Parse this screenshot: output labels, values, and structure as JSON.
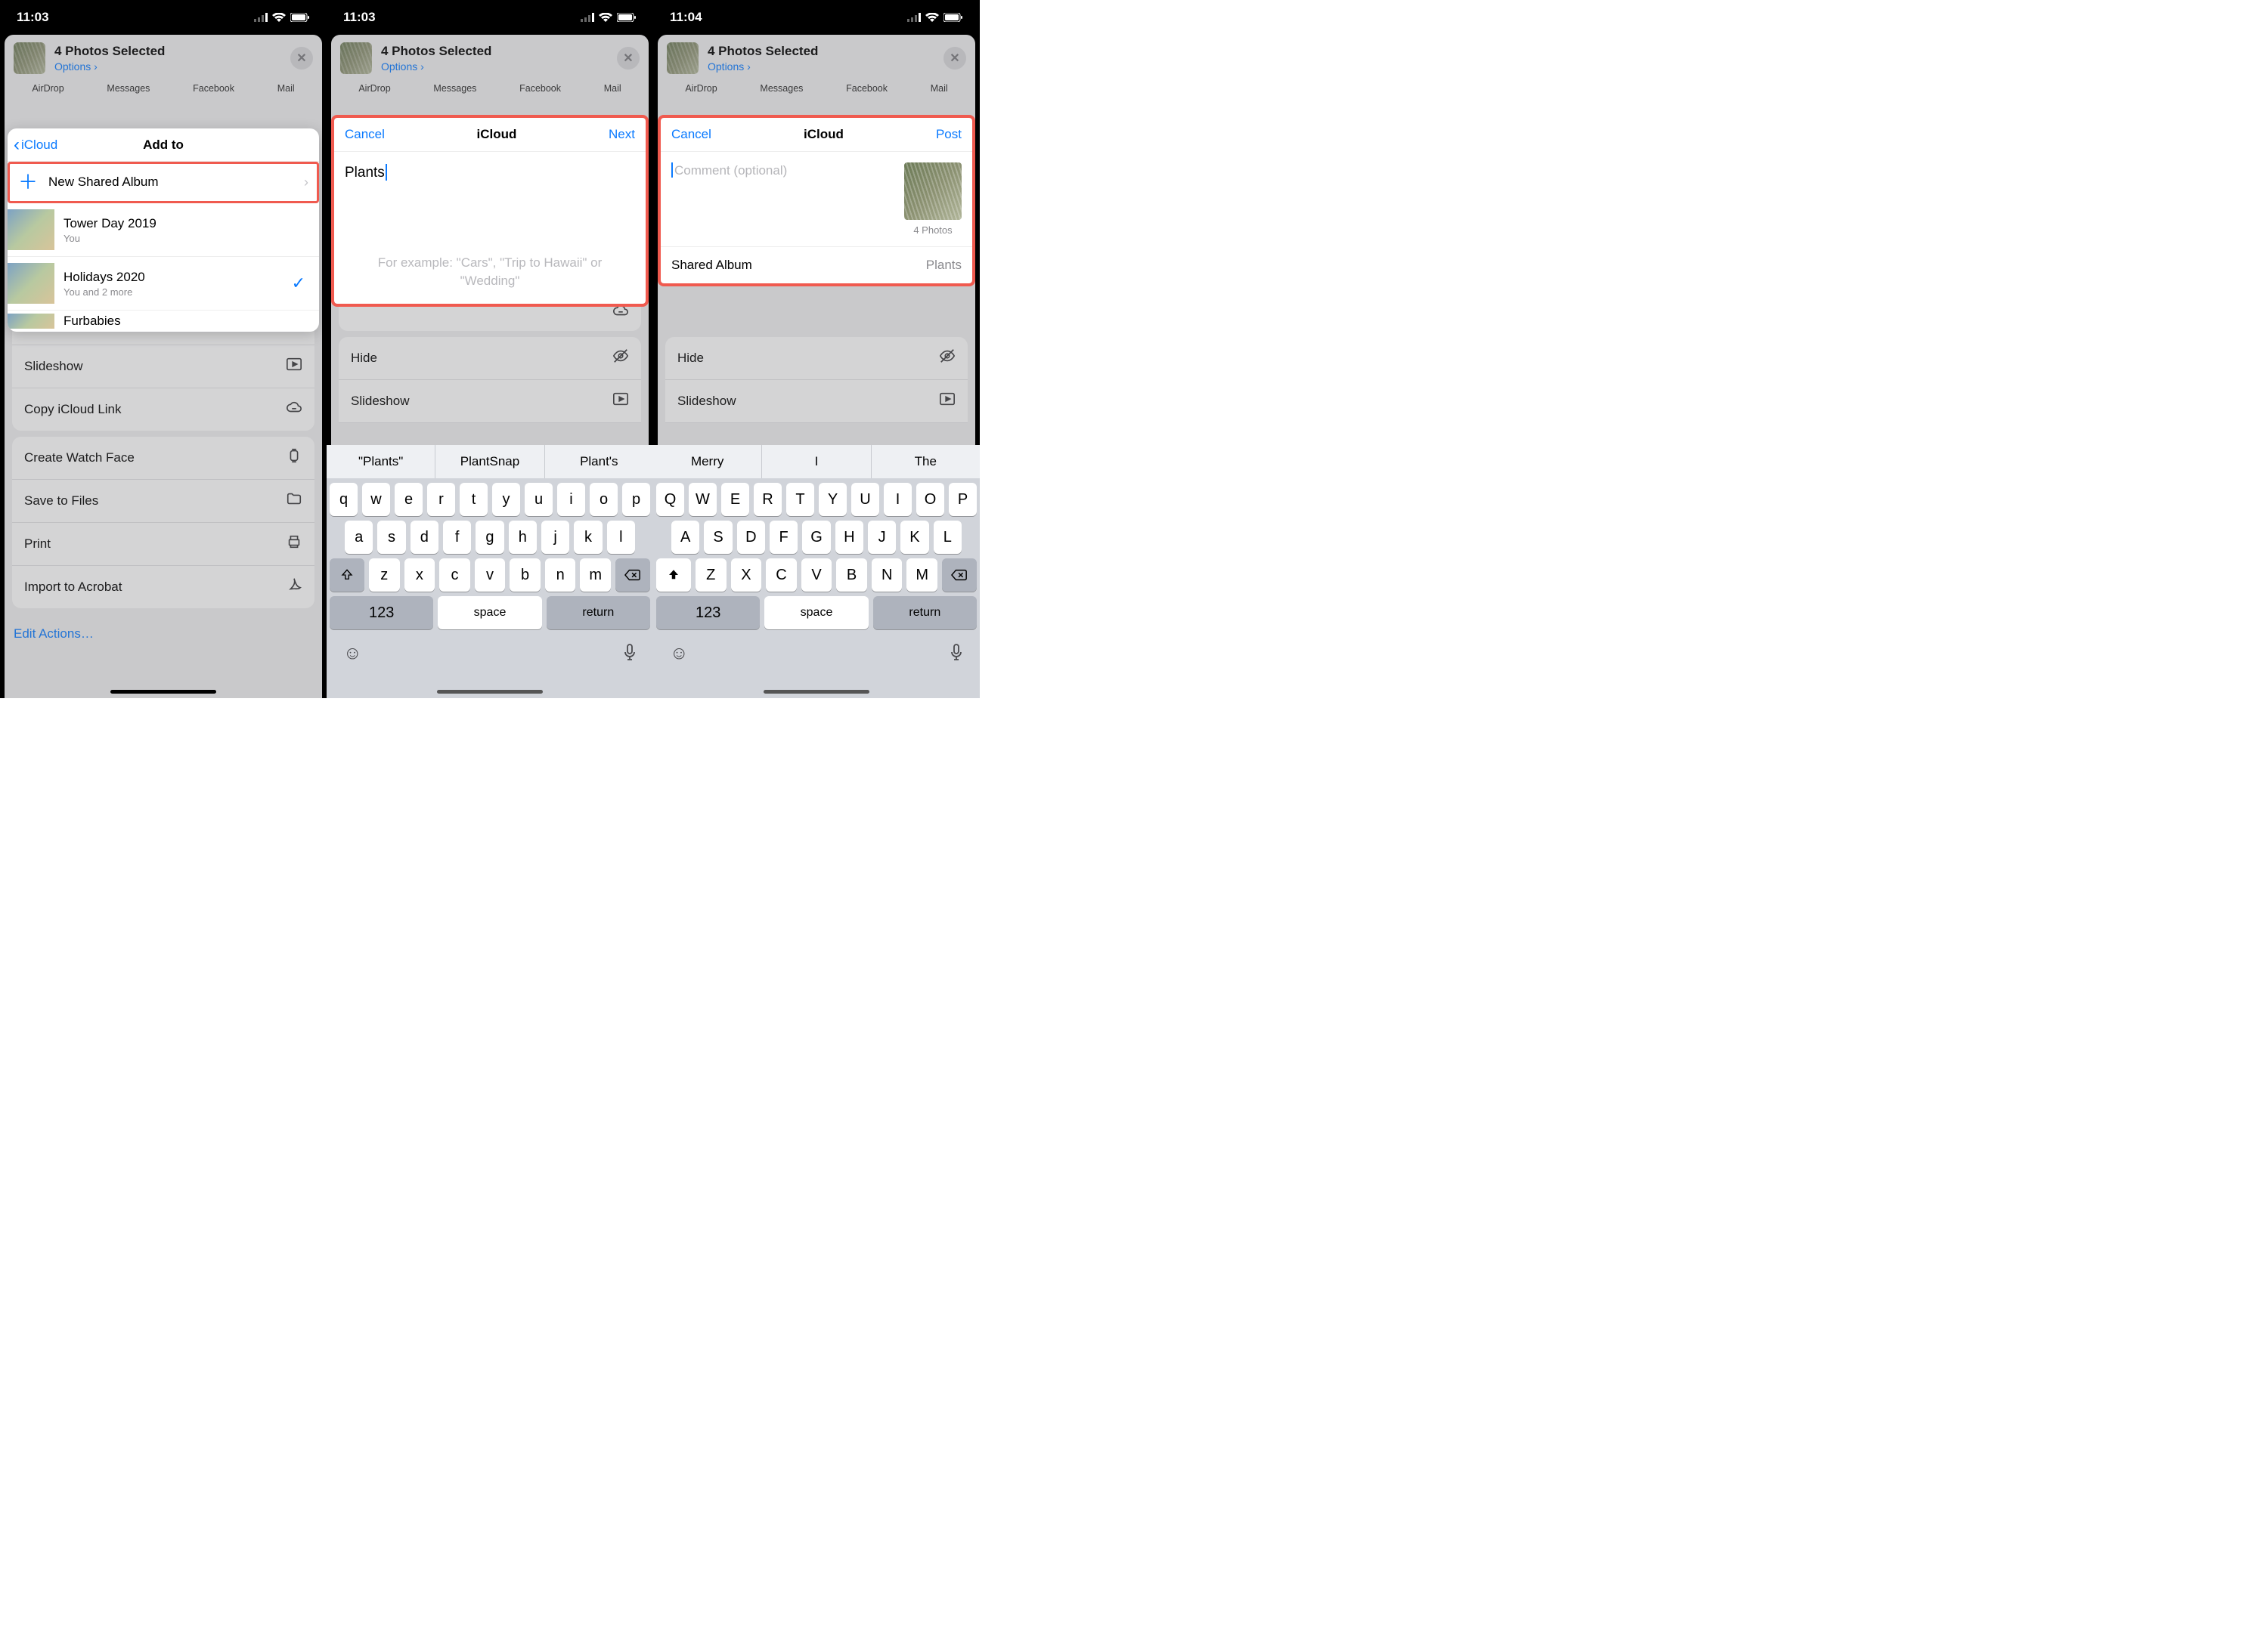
{
  "status": {
    "time1": "11:03",
    "time2": "11:03",
    "time3": "11:04"
  },
  "shareHeader": {
    "title": "4 Photos Selected",
    "options": "Options",
    "targets": [
      "AirDrop",
      "Messages",
      "Facebook",
      "Mail"
    ]
  },
  "actions": {
    "hide": "Hide",
    "slideshow": "Slideshow",
    "copyLink": "Copy iCloud Link",
    "watch": "Create Watch Face",
    "save": "Save to Files",
    "print": "Print",
    "import": "Import to Acrobat",
    "edit": "Edit Actions…"
  },
  "popover1": {
    "back": "iCloud",
    "title": "Add to",
    "newAlbum": "New Shared Album",
    "albums": [
      {
        "title": "Tower Day 2019",
        "sub": "You",
        "checked": false
      },
      {
        "title": "Holidays 2020",
        "sub": "You and 2 more",
        "checked": true
      },
      {
        "title": "Furbabies",
        "sub": "",
        "checked": false
      }
    ]
  },
  "sheet2": {
    "cancel": "Cancel",
    "title": "iCloud",
    "next": "Next",
    "input": "Plants",
    "hint": "For example: \"Cars\", \"Trip to Hawaii\" or \"Wedding\""
  },
  "sheet3": {
    "cancel": "Cancel",
    "title": "iCloud",
    "post": "Post",
    "placeholder": "Comment (optional)",
    "photoCount": "4 Photos",
    "sharedLabel": "Shared Album",
    "sharedValue": "Plants"
  },
  "kb2": {
    "sugs": [
      "\"Plants\"",
      "PlantSnap",
      "Plant's"
    ],
    "r1": [
      "q",
      "w",
      "e",
      "r",
      "t",
      "y",
      "u",
      "i",
      "o",
      "p"
    ],
    "r2": [
      "a",
      "s",
      "d",
      "f",
      "g",
      "h",
      "j",
      "k",
      "l"
    ],
    "r3": [
      "z",
      "x",
      "c",
      "v",
      "b",
      "n",
      "m"
    ],
    "k123": "123",
    "space": "space",
    "return": "return"
  },
  "kb3": {
    "sugs": [
      "Merry",
      "I",
      "The"
    ],
    "r1": [
      "Q",
      "W",
      "E",
      "R",
      "T",
      "Y",
      "U",
      "I",
      "O",
      "P"
    ],
    "r2": [
      "A",
      "S",
      "D",
      "F",
      "G",
      "H",
      "J",
      "K",
      "L"
    ],
    "r3": [
      "Z",
      "X",
      "C",
      "V",
      "B",
      "N",
      "M"
    ],
    "k123": "123",
    "space": "space",
    "return": "return"
  }
}
